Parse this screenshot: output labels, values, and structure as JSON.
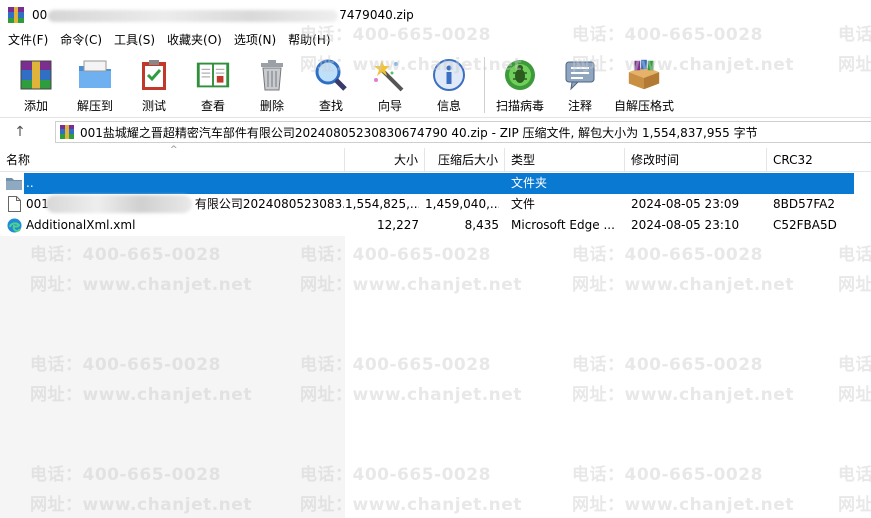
{
  "window": {
    "title_prefix": "00",
    "title_suffix": "7479040.zip"
  },
  "menu": [
    "文件(F)",
    "命令(C)",
    "工具(S)",
    "收藏夹(O)",
    "选项(N)",
    "帮助(H)"
  ],
  "toolbar": [
    {
      "label": "添加",
      "icon": "archive-add-icon"
    },
    {
      "label": "解压到",
      "icon": "folder-extract-icon"
    },
    {
      "label": "测试",
      "icon": "clipboard-check-icon"
    },
    {
      "label": "查看",
      "icon": "book-view-icon"
    },
    {
      "label": "删除",
      "icon": "trash-icon"
    },
    {
      "label": "查找",
      "icon": "magnifier-icon"
    },
    {
      "label": "向导",
      "icon": "magic-wand-icon"
    },
    {
      "label": "信息",
      "icon": "info-icon"
    },
    {
      "label": "扫描病毒",
      "icon": "virus-scan-icon"
    },
    {
      "label": "注释",
      "icon": "comment-icon"
    },
    {
      "label": "自解压格式",
      "icon": "sfx-box-icon"
    }
  ],
  "address": {
    "up": "↑",
    "path": "001盐城耀之晋超精密汽车部件有限公司20240805230830674790 40.zip - ZIP 压缩文件, 解包大小为 1,554,837,955 字节"
  },
  "columns": {
    "name": "名称",
    "size": "大小",
    "packed": "压缩后大小",
    "type": "类型",
    "modified": "修改时间",
    "crc": "CRC32"
  },
  "rows": [
    {
      "name": "..",
      "size": "",
      "packed": "",
      "type": "文件夹",
      "modified": "",
      "crc": ""
    },
    {
      "name_prefix": "001",
      "name_suffix": "有限公司2024080523083...",
      "size": "1,554,825,...",
      "packed": "1,459,040,...",
      "type": "文件",
      "modified": "2024-08-05 23:09",
      "crc": "8BD57FA2"
    },
    {
      "name": "AdditionalXml.xml",
      "size": "12,227",
      "packed": "8,435",
      "type": "Microsoft Edge ...",
      "modified": "2024-08-05 23:10",
      "crc": "C52FBA5D"
    }
  ],
  "watermark": {
    "phone": "电话：400-665-0028",
    "site": "网址：www.chanjet.net",
    "phone_short": "电话",
    "site_short": "网址"
  },
  "colors": {
    "selection": "#0a79d1",
    "folder": "#e8b93b"
  }
}
